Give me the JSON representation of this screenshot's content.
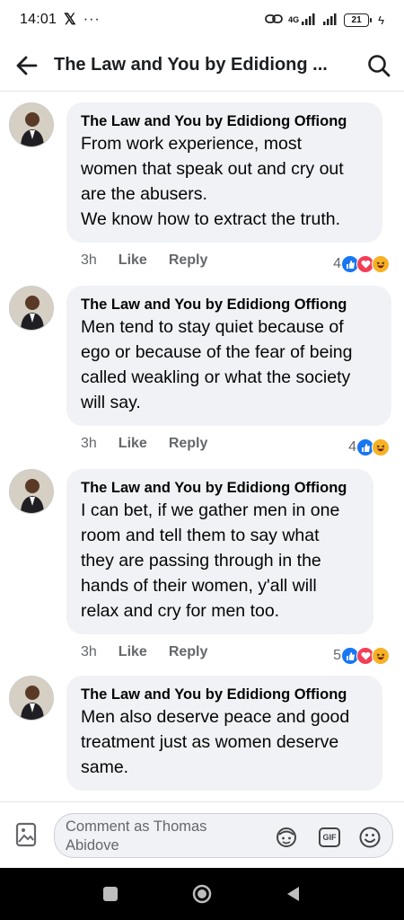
{
  "status_bar": {
    "time": "14:01",
    "network": "4G",
    "battery": "21"
  },
  "header": {
    "title": "The Law and You by Edidiong ..."
  },
  "comments": [
    {
      "author": "The Law and You by Edidiong Offiong",
      "lines": [
        "From work experience, most",
        "women that speak out and cry out",
        "are the abusers.",
        "We know how to extract the truth."
      ],
      "time": "3h",
      "like_label": "Like",
      "reply_label": "Reply",
      "reaction_count": "4",
      "reactions": [
        "like-icon",
        "love-icon",
        "haha-icon"
      ]
    },
    {
      "author": "The Law and You by Edidiong Offiong",
      "lines": [
        "Men tend to stay quiet because of",
        "ego or because of the fear of being",
        "called weakling or what the society",
        "will say."
      ],
      "time": "3h",
      "like_label": "Like",
      "reply_label": "Reply",
      "reaction_count": "4",
      "reactions": [
        "like-icon",
        "haha-icon"
      ]
    },
    {
      "author": "The Law and You by Edidiong Offiong",
      "lines": [
        "I can bet, if we gather men in one",
        "room and tell them to say what",
        "they are passing through in the",
        "hands of their women, y'all will",
        "relax and cry for men too."
      ],
      "time": "3h",
      "like_label": "Like",
      "reply_label": "Reply",
      "reaction_count": "5",
      "reactions": [
        "like-icon",
        "love-icon",
        "haha-icon"
      ]
    },
    {
      "author": "The Law and You by Edidiong Offiong",
      "lines": [
        "Men also deserve peace and good",
        "treatment just as women deserve",
        "same."
      ]
    }
  ],
  "composer": {
    "placeholder": "Comment as Thomas Abidove",
    "gif_label": "GIF"
  },
  "colors": {
    "bubble": "#f0f2f5",
    "meta_text": "#65676b",
    "like_blue": "#1877f2",
    "love_red": "#f33e58",
    "haha_yellow": "#f7b125"
  }
}
